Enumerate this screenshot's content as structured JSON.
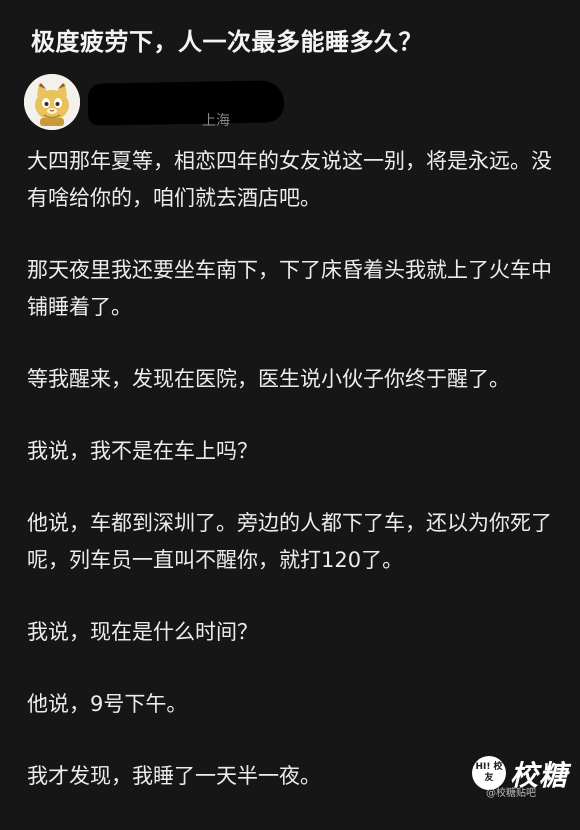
{
  "question": {
    "title": "极度疲劳下，人一次最多能睡多久？"
  },
  "author": {
    "avatar_icon": "cartoon-cat-avatar-icon",
    "location": "上海",
    "name_redacted": true
  },
  "answer": {
    "paragraphs": [
      "大四那年夏等，相恋四年的女友说这一别，将是永远。没有啥给你的，咱们就去酒店吧。",
      "那天夜里我还要坐车南下，下了床昏着头我就上了火车中铺睡着了。",
      "等我醒来，发现在医院，医生说小伙子你终于醒了。",
      "我说，我不是在车上吗？",
      "他说，车都到深圳了。旁边的人都下了车，还以为你死了呢，列车员一直叫不醒你，就打120了。",
      "我说，现在是什么时间？",
      "他说，9号下午。",
      "我才发现，我睡了一天半一夜。"
    ]
  },
  "watermark": {
    "badge_text": "HI! 校友",
    "brand": "校糖",
    "sub": "@校糖贴吧"
  },
  "colors": {
    "background": "#161616",
    "text": "#ececec",
    "title": "#f4f4f4"
  }
}
